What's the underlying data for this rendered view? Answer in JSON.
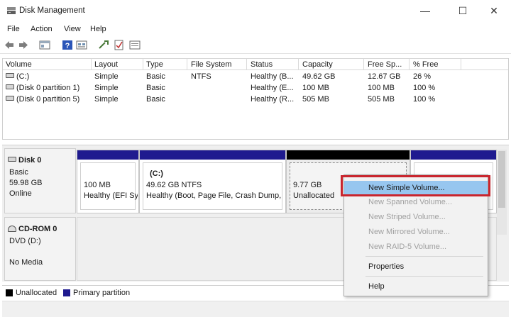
{
  "window": {
    "title": "Disk Management",
    "minimize_glyph": "—",
    "maximize_glyph": "☐",
    "close_glyph": "✕"
  },
  "menu": [
    "File",
    "Action",
    "View",
    "Help"
  ],
  "toolbar_icons": [
    "back-arrow-icon",
    "forward-arrow-icon",
    "console-tree-icon",
    "help-icon",
    "properties-icon",
    "rescan-icon",
    "check-icon",
    "refresh-icon"
  ],
  "volume_table": {
    "headers": [
      "Volume",
      "Layout",
      "Type",
      "File System",
      "Status",
      "Capacity",
      "Free Sp...",
      "% Free"
    ],
    "rows": [
      [
        "(C:)",
        "Simple",
        "Basic",
        "NTFS",
        "Healthy (B...",
        "49.62 GB",
        "12.67 GB",
        "26 %"
      ],
      [
        "(Disk 0 partition 1)",
        "Simple",
        "Basic",
        "",
        "Healthy (E...",
        "100 MB",
        "100 MB",
        "100 %"
      ],
      [
        "(Disk 0 partition 5)",
        "Simple",
        "Basic",
        "",
        "Healthy (R...",
        "505 MB",
        "505 MB",
        "100 %"
      ]
    ]
  },
  "disks": {
    "disk0": {
      "name": "Disk 0",
      "type": "Basic",
      "size": "59.98 GB",
      "status": "Online",
      "partitions": [
        {
          "size": "100 MB",
          "status": "Healthy (EFI Sy"
        },
        {
          "name": "(C:)",
          "size": "49.62 GB NTFS",
          "status": "Healthy (Boot, Page File, Crash Dump,"
        },
        {
          "size": "9.77 GB",
          "status": "Unallocated"
        },
        {
          "size": "",
          "status": ""
        }
      ]
    },
    "cdrom0": {
      "name": "CD-ROM 0",
      "drive": "DVD (D:)",
      "media": "No Media"
    }
  },
  "legend": {
    "unallocated": "Unallocated",
    "primary": "Primary partition",
    "unallocated_color": "#000000",
    "primary_color": "#1f1a8f"
  },
  "context_menu": {
    "items": [
      {
        "label": "New Simple Volume...",
        "enabled": true
      },
      {
        "label": "New Spanned Volume...",
        "enabled": false
      },
      {
        "label": "New Striped Volume...",
        "enabled": false
      },
      {
        "label": "New Mirrored Volume...",
        "enabled": false
      },
      {
        "label": "New RAID-5 Volume...",
        "enabled": false
      },
      {
        "label": "Properties",
        "enabled": true
      },
      {
        "label": "Help",
        "enabled": true
      }
    ]
  },
  "colors": {
    "primary_band": "#1f1a8f",
    "unallocated_band": "#000000",
    "highlight": "#97c6ef",
    "callout_border": "#c9252e"
  }
}
